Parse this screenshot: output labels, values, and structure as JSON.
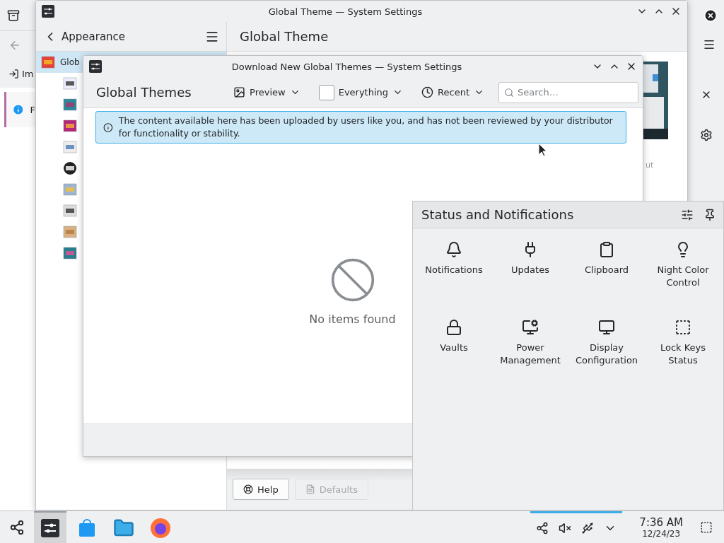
{
  "background_app": {
    "import_label": "Im",
    "banner_text": "F"
  },
  "settings_window": {
    "title": "Global Theme — System Settings",
    "back_label": "Appearance",
    "sidebar_items": [
      {
        "label": "Glob",
        "selected": true
      },
      {
        "selected": false
      },
      {
        "selected": false
      },
      {
        "selected": false
      },
      {
        "selected": false
      },
      {
        "selected": false
      },
      {
        "selected": false
      },
      {
        "selected": false
      },
      {
        "selected": false
      },
      {
        "selected": false
      }
    ],
    "page_title": "Global Theme",
    "preview_caption": "ut",
    "buttons": [
      {
        "label": "Help",
        "disabled": false
      },
      {
        "label": "Defaults",
        "disabled": true
      }
    ]
  },
  "dialog": {
    "title": "Download New Global Themes — System Settings",
    "heading": "Global Themes",
    "filters": [
      {
        "kind": "menu",
        "label": "Preview"
      },
      {
        "kind": "checkbox",
        "label": "Everything",
        "checked": false
      },
      {
        "kind": "menu",
        "label": "Recent"
      }
    ],
    "search": {
      "placeholder": "Search…"
    },
    "notice": "The content available here has been uploaded by users like you, and has not been reviewed by your distributor for functionality or stability.",
    "empty_message": "No items found"
  },
  "status_panel": {
    "title": "Status and Notifications",
    "items": [
      {
        "label": "Notifications"
      },
      {
        "label": "Updates"
      },
      {
        "label": "Clipboard"
      },
      {
        "label": "Night Color Control"
      },
      {
        "label": "Vaults"
      },
      {
        "label": "Power Management"
      },
      {
        "label": "Display Configuration"
      },
      {
        "label": "Lock Keys Status"
      }
    ]
  },
  "taskbar": {
    "tasks": [
      {
        "selected": true
      },
      {
        "selected": false
      },
      {
        "selected": false
      },
      {
        "selected": false
      }
    ],
    "time": "7:36 AM",
    "date": "12/24/23"
  }
}
